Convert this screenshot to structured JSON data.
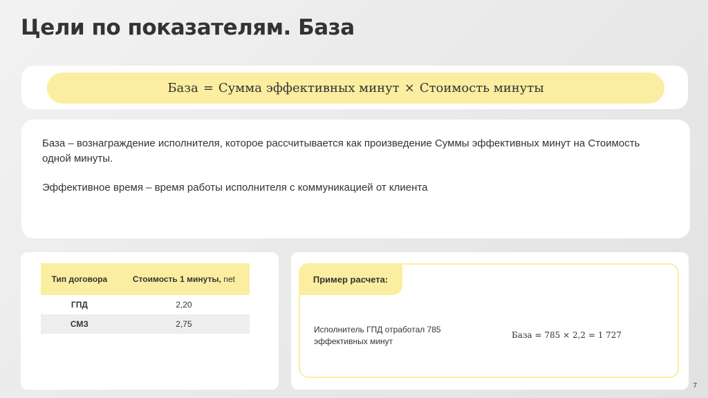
{
  "slide": {
    "title": "Цели по показателям. База",
    "page_number": "7"
  },
  "formula": {
    "left": "База",
    "equals": "=",
    "term1": "Сумма эффективных минут",
    "times": "×",
    "term2": "Стоимость минуты"
  },
  "description": {
    "paragraph1": "База – вознаграждение исполнителя, которое рассчитывается как произведение Суммы эффективных минут на Стоимость одной минуты.",
    "paragraph2": "Эффективное время – время работы исполнителя с коммуникацией от клиента"
  },
  "rate_table": {
    "header_type": "Тип договора",
    "header_cost": "Стоимость 1 минуты,",
    "header_net": " net",
    "rows": [
      {
        "type": "ГПД",
        "cost": "2,20"
      },
      {
        "type": "СМЗ",
        "cost": "2,75"
      }
    ]
  },
  "example": {
    "tab_label": "Пример расчета:",
    "description": "Исполнитель ГПД отработал 785 эффективных минут",
    "formula": "База = 785 × 2,2 = 1 727"
  },
  "colors": {
    "accent_yellow": "#fbeea0",
    "text": "#333333",
    "card": "#ffffff"
  }
}
